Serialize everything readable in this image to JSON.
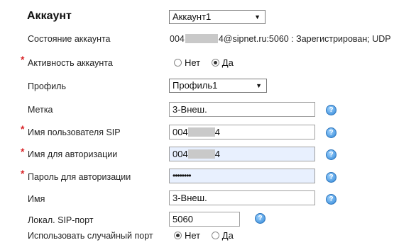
{
  "header": {
    "title": "Аккаунт",
    "account_select": "Аккаунт1"
  },
  "status": {
    "label": "Состояние аккаунта",
    "value_prefix": "004",
    "value_suffix": "4@sipnet.ru:5060 : Зарегистрирован; UDP"
  },
  "activity": {
    "label": "Активность аккаунта",
    "options": [
      "Нет",
      "Да"
    ],
    "selected": "Да"
  },
  "profile": {
    "label": "Профиль",
    "value": "Профиль1"
  },
  "tag": {
    "label": "Метка",
    "value": "3-Внеш."
  },
  "sip_user": {
    "label": "Имя пользователя SIP",
    "value_prefix": "004",
    "value_suffix": "4"
  },
  "auth_name": {
    "label": "Имя для авторизации",
    "value_prefix": "004",
    "value_suffix": "4"
  },
  "auth_password": {
    "label": "Пароль для авторизации",
    "value": "••••••••"
  },
  "name": {
    "label": "Имя",
    "value": "3-Внеш."
  },
  "sip_port": {
    "label": "Локал. SIP-порт",
    "value": "5060"
  },
  "random_port": {
    "label": "Использовать случайный порт",
    "options": [
      "Нет",
      "Да"
    ],
    "selected": "Нет"
  },
  "help_icon": "?",
  "required_mark": "*",
  "colors": {
    "required": "#d9262a",
    "help_icon": "#2f86d6",
    "autofill_bg": "#e8f0fe"
  }
}
